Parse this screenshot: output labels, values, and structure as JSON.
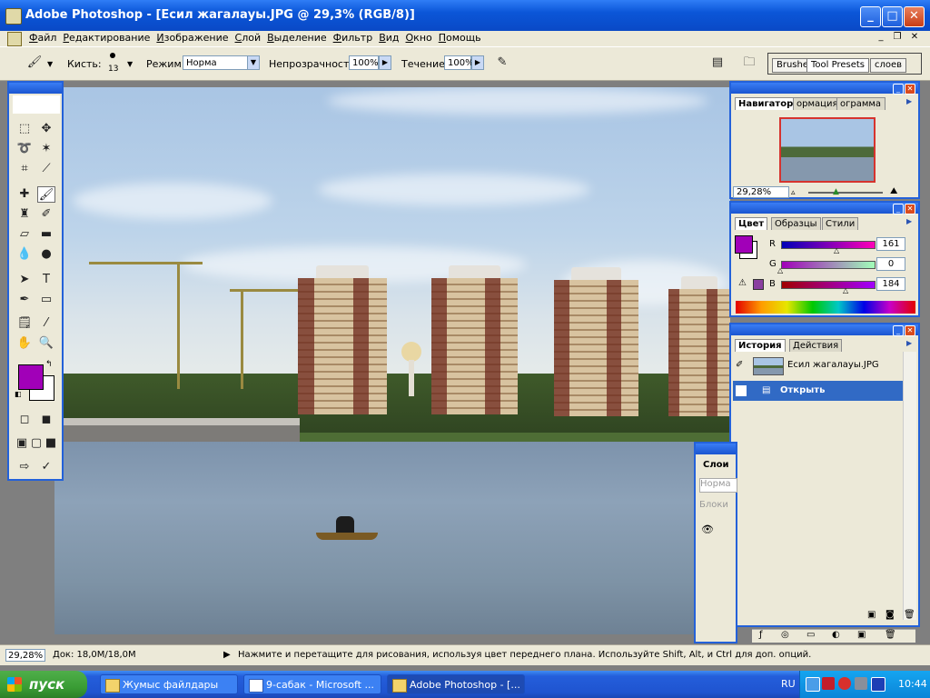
{
  "window": {
    "title": "Adobe Photoshop - [Есил жагалауы.JPG @ 29,3% (RGB/8)]",
    "buttons": {
      "minimize": "_",
      "maximize": "□",
      "close": "✕"
    }
  },
  "menu": [
    "Файл",
    "Редактирование",
    "Изображение",
    "Слой",
    "Выделение",
    "Фильтр",
    "Вид",
    "Окно",
    "Помощь"
  ],
  "options": {
    "brush_label": "Кисть:",
    "brush_size": "13",
    "mode_label": "Режим:",
    "mode_value": "Норма",
    "opacity_label": "Непрозрачность:",
    "opacity_value": "100%",
    "flow_label": "Течение:",
    "flow_value": "100%",
    "well_tabs": [
      "Brushe",
      "Tool Presets",
      "слоев"
    ]
  },
  "navigator": {
    "tabs": [
      "Навигатор",
      "ормация",
      "ограмма"
    ],
    "zoom": "29,28%"
  },
  "color": {
    "tabs": [
      "Цвет",
      "Образцы",
      "Стили"
    ],
    "channels": [
      {
        "name": "R",
        "value": "161"
      },
      {
        "name": "G",
        "value": "0"
      },
      {
        "name": "B",
        "value": "184"
      }
    ],
    "fg_color": "#a100b8",
    "bg_color": "#ffffff"
  },
  "history": {
    "tabs": [
      "История",
      "Действия"
    ],
    "snapshot": "Есил жагалауы.JPG",
    "items": [
      "Открыть"
    ]
  },
  "layers": {
    "tab": "Слои",
    "mode": "Норма",
    "lock": "Блоки"
  },
  "status": {
    "zoom": "29,28%",
    "doc": "Док: 18,0M/18,0M",
    "message": "Нажмите и перетащите для рисования, используя цвет переднего плана. Используйте Shift, Alt, и Ctrl для доп. опций."
  },
  "taskbar": {
    "start": "пуск",
    "tasks": [
      "Жумыс файлдары",
      "9-сабак - Microsoft ...",
      "Adobe Photoshop - [..."
    ],
    "lang": "RU",
    "clock": "10:44"
  }
}
